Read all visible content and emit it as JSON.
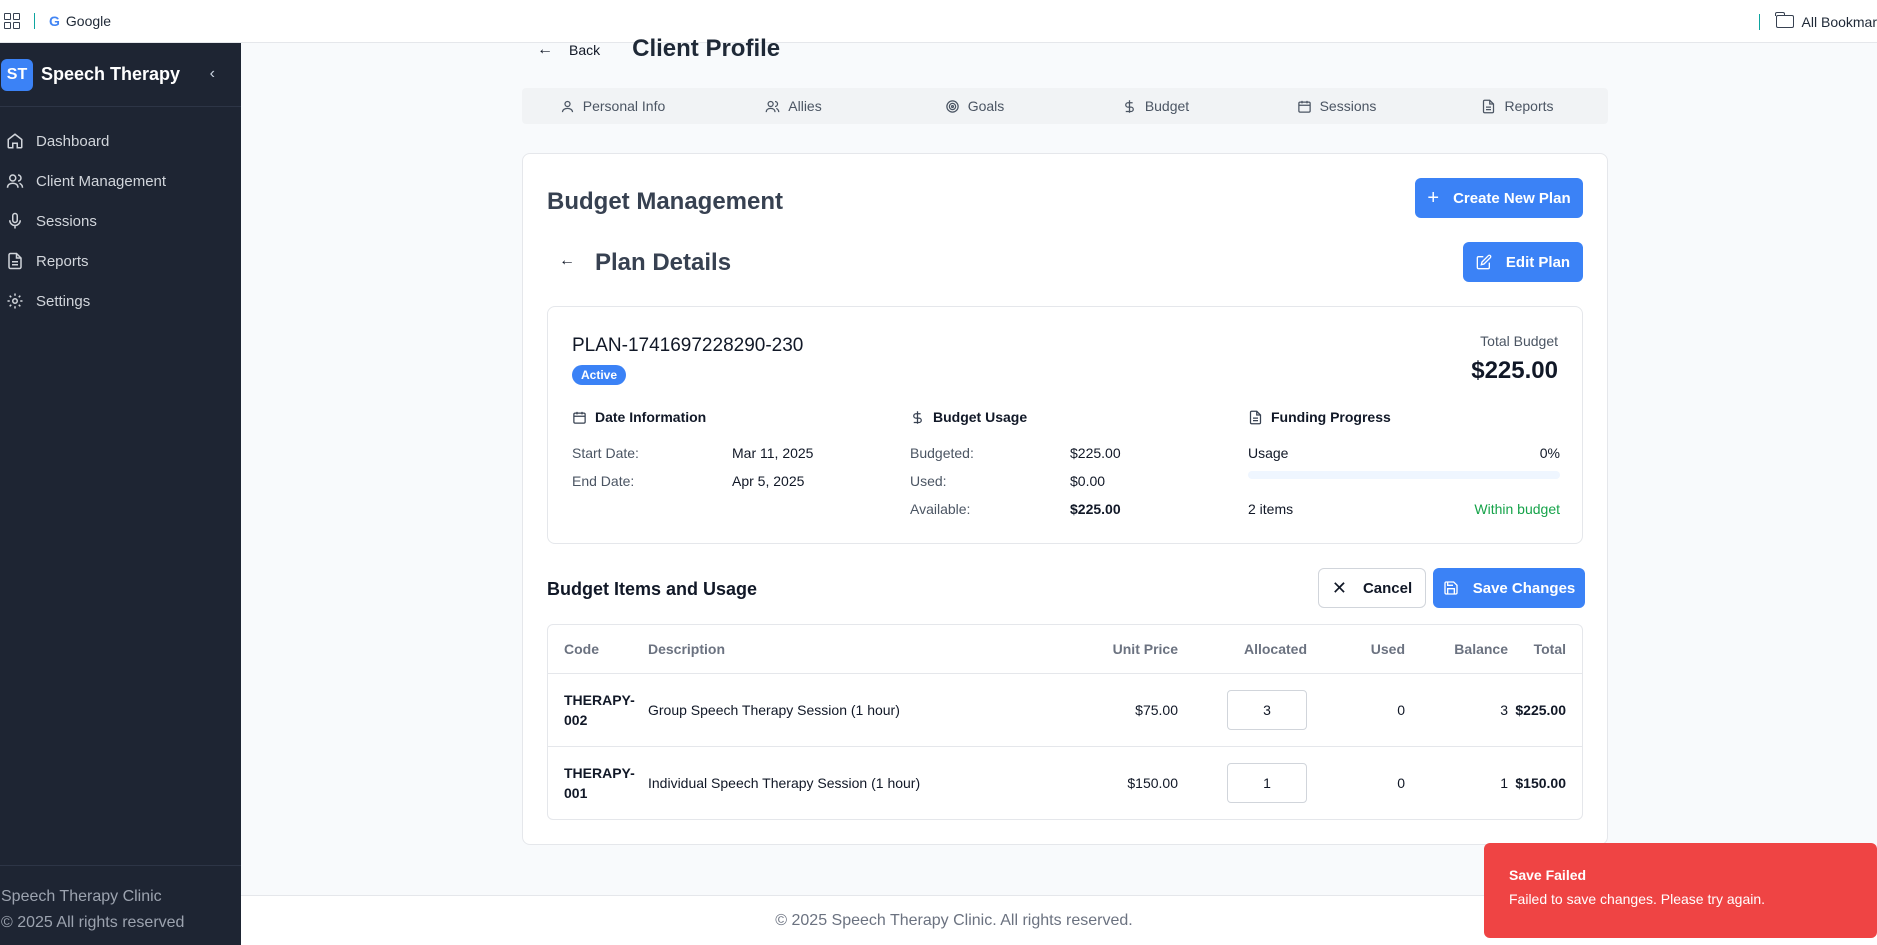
{
  "browser": {
    "bookmark_google": "Google",
    "all_bookmarks": "All Bookmar"
  },
  "sidebar": {
    "logo": "ST",
    "title": "Speech Therapy",
    "items": [
      {
        "label": "Dashboard",
        "icon": "home-icon"
      },
      {
        "label": "Client Management",
        "icon": "users-icon"
      },
      {
        "label": "Sessions",
        "icon": "microphone-icon"
      },
      {
        "label": "Reports",
        "icon": "file-icon"
      },
      {
        "label": "Settings",
        "icon": "gear-icon"
      }
    ],
    "footer_name": "Speech Therapy Clinic",
    "footer_copy": "© 2025 All rights reserved"
  },
  "header": {
    "back_label": "Back",
    "page_title": "Client Profile"
  },
  "tabs": [
    {
      "label": "Personal Info",
      "icon": "user-icon"
    },
    {
      "label": "Allies",
      "icon": "users-icon"
    },
    {
      "label": "Goals",
      "icon": "target-icon"
    },
    {
      "label": "Budget",
      "icon": "dollar-icon"
    },
    {
      "label": "Sessions",
      "icon": "calendar-icon"
    },
    {
      "label": "Reports",
      "icon": "file-icon"
    }
  ],
  "budget": {
    "title": "Budget Management",
    "create_label": "Create New Plan",
    "plan_details_title": "Plan Details",
    "edit_label": "Edit Plan",
    "plan_id": "PLAN-1741697228290-230",
    "status": "Active",
    "total_label": "Total Budget",
    "total_value": "$225.00",
    "date_info": {
      "title": "Date Information",
      "start_label": "Start Date:",
      "start_value": "Mar 11, 2025",
      "end_label": "End Date:",
      "end_value": "Apr 5, 2025"
    },
    "usage": {
      "title": "Budget Usage",
      "budgeted_label": "Budgeted:",
      "budgeted_value": "$225.00",
      "used_label": "Used:",
      "used_value": "$0.00",
      "available_label": "Available:",
      "available_value": "$225.00"
    },
    "funding": {
      "title": "Funding Progress",
      "usage_label": "Usage",
      "usage_percent": "0%",
      "progress_fraction": 0.0,
      "items_count": "2 items",
      "status_text": "Within budget"
    }
  },
  "items": {
    "title": "Budget Items and Usage",
    "cancel_label": "Cancel",
    "save_label": "Save Changes",
    "columns": [
      "Code",
      "Description",
      "Unit Price",
      "Allocated",
      "Used",
      "Balance",
      "Total"
    ],
    "rows": [
      {
        "code_line1": "THERAPY-",
        "code_line2": "002",
        "description": "Group Speech Therapy Session (1 hour)",
        "unit_price": "$75.00",
        "allocated": "3",
        "used": "0",
        "balance": "3",
        "total": "$225.00"
      },
      {
        "code_line1": "THERAPY-",
        "code_line2": "001",
        "description": "Individual Speech Therapy Session (1 hour)",
        "unit_price": "$150.00",
        "allocated": "1",
        "used": "0",
        "balance": "1",
        "total": "$150.00"
      }
    ]
  },
  "footer": {
    "text": "© 2025 Speech Therapy Clinic. All rights reserved."
  },
  "toast": {
    "title": "Save Failed",
    "message": "Failed to save changes. Please try again."
  },
  "colors": {
    "accent": "#3b82f6",
    "sidebar_bg": "#1e2533",
    "success": "#16a34a",
    "error": "#ef4444"
  }
}
